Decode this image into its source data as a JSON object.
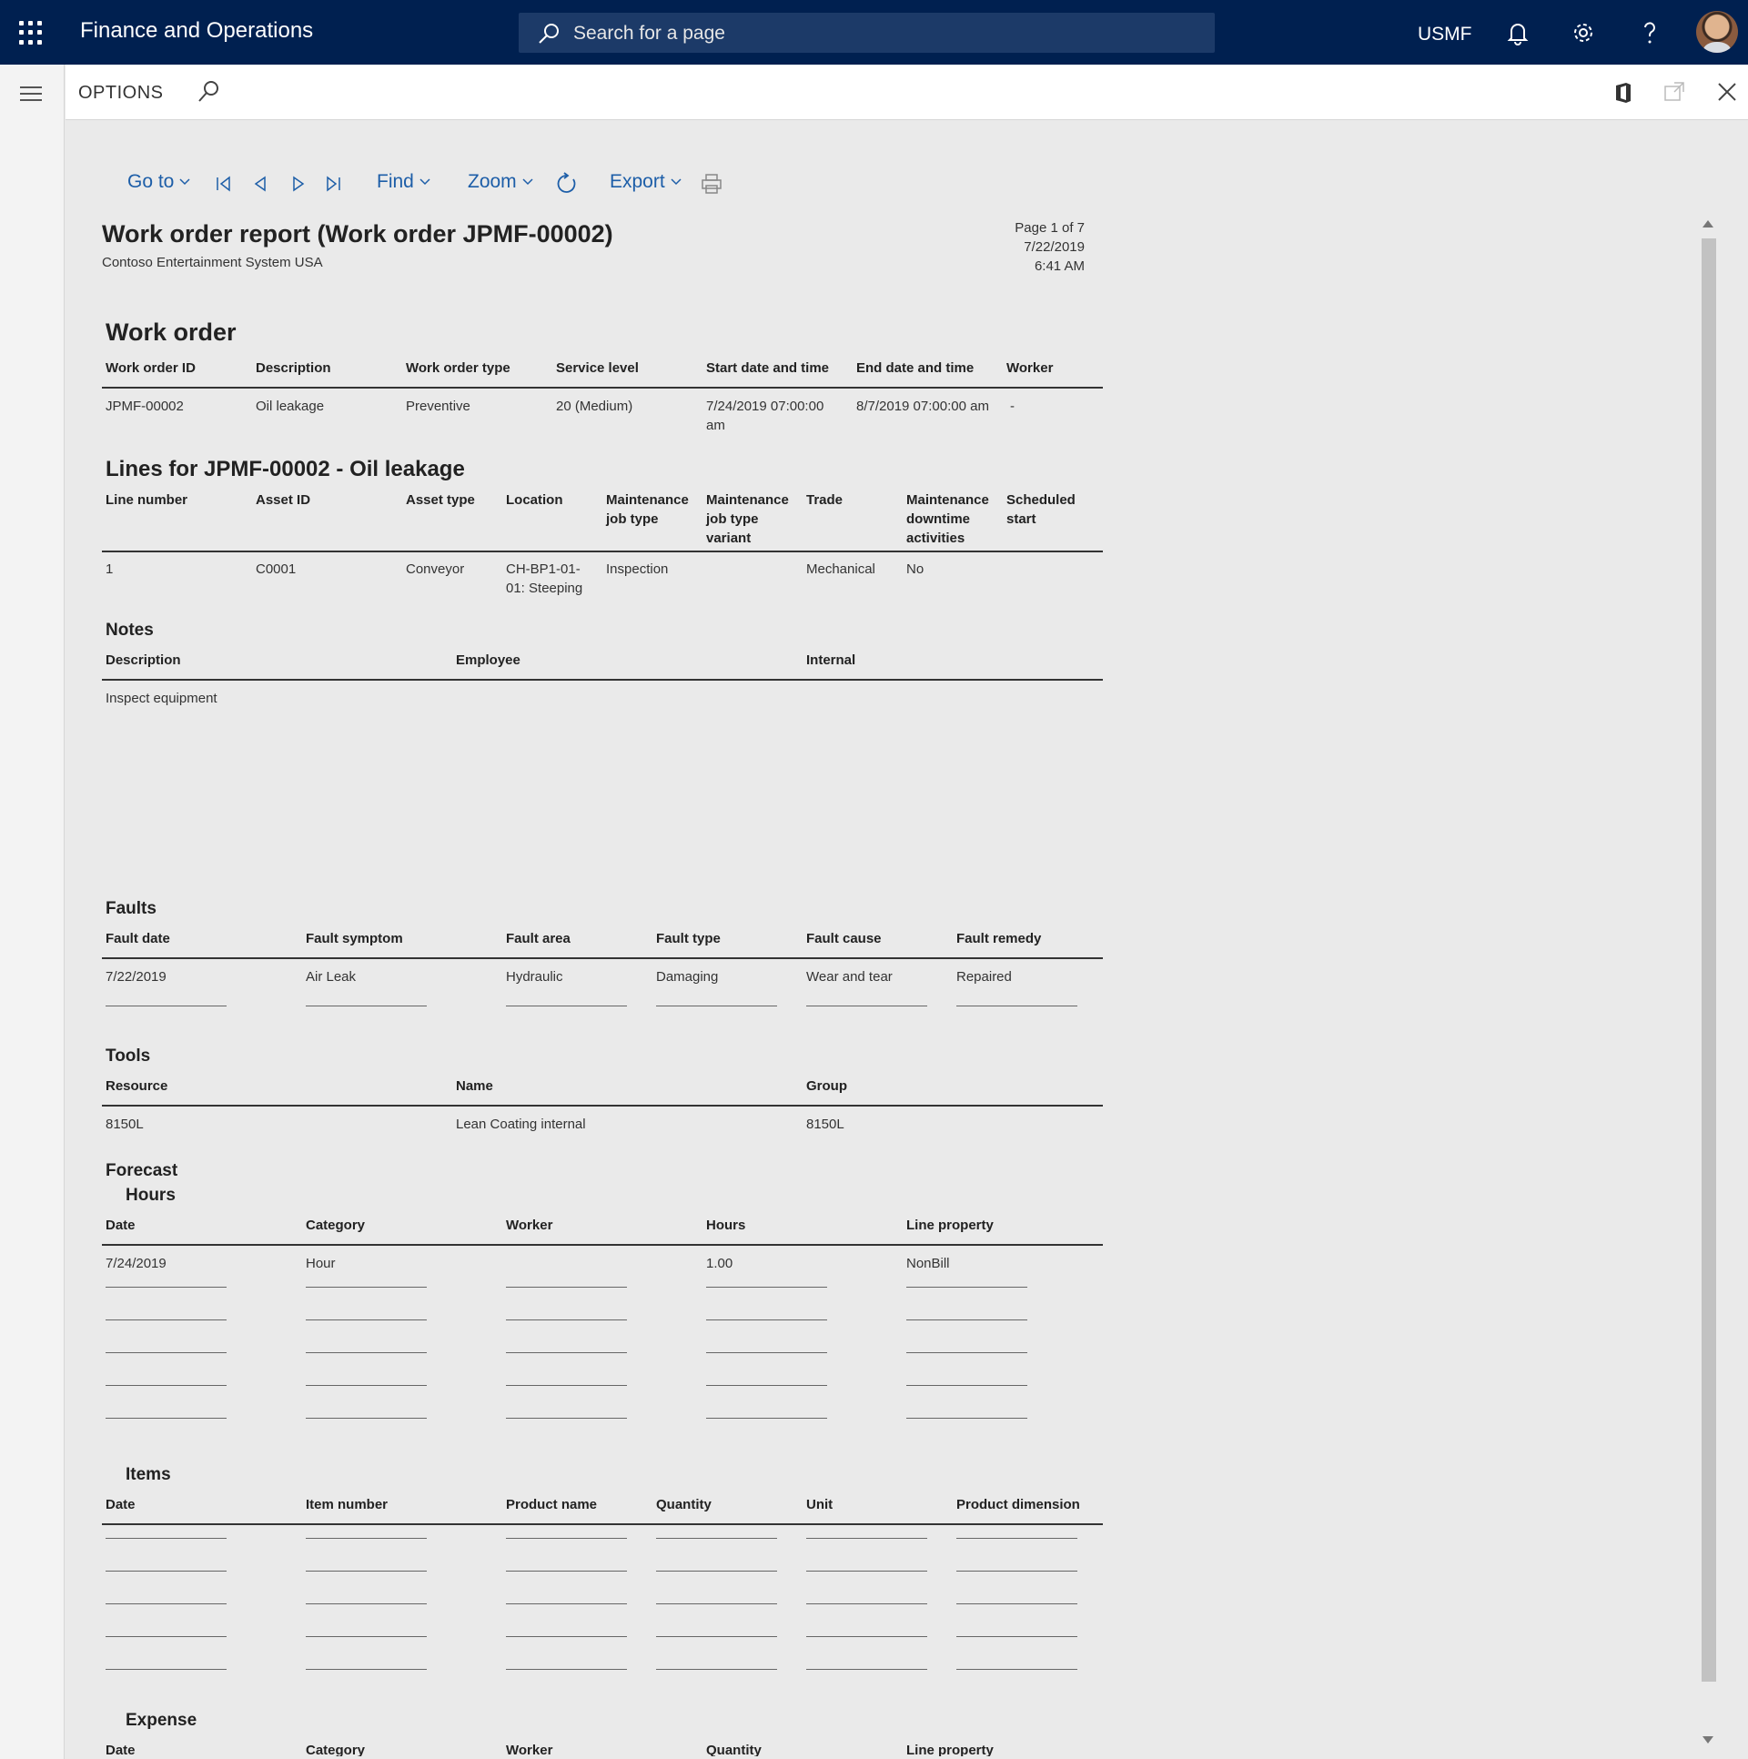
{
  "topbar": {
    "app_title": "Finance and Operations",
    "search_placeholder": "Search for a page",
    "company": "USMF"
  },
  "options": {
    "label": "OPTIONS"
  },
  "toolbar": {
    "goto": "Go to",
    "find": "Find",
    "zoom": "Zoom",
    "export": "Export"
  },
  "report": {
    "title": "Work order report (Work order JPMF-00002)",
    "company": "Contoso Entertainment System USA",
    "page": "Page 1 of 7",
    "date": "7/22/2019",
    "time": "6:41 AM",
    "work_order": {
      "heading": "Work order",
      "headers": [
        "Work order ID",
        "Description",
        "Work order type",
        "Service level",
        "Start date and time",
        "End date and time",
        "Worker"
      ],
      "row": [
        "JPMF-00002",
        "Oil leakage",
        "Preventive",
        "20 (Medium)",
        "7/24/2019 07:00:00 am",
        "8/7/2019 07:00:00 am",
        "-"
      ]
    },
    "lines": {
      "heading": "Lines for JPMF-00002 - Oil leakage",
      "headers": [
        "Line number",
        "Asset ID",
        "Asset type",
        "Location",
        "Maintenance job type",
        "Maintenance job type variant",
        "Trade",
        "Maintenance downtime activities",
        "Scheduled start"
      ],
      "row": [
        "1",
        "C0001",
        "Conveyor",
        "CH-BP1-01-01: Steeping",
        "Inspection",
        "",
        "Mechanical",
        "No",
        ""
      ]
    },
    "notes": {
      "heading": "Notes",
      "headers": [
        "Description",
        "Employee",
        "Internal"
      ],
      "row": [
        "Inspect equipment",
        "",
        ""
      ]
    },
    "faults": {
      "heading": "Faults",
      "headers": [
        "Fault date",
        "Fault symptom",
        "Fault area",
        "Fault type",
        "Fault cause",
        "Fault remedy"
      ],
      "row": [
        "7/22/2019",
        "Air Leak",
        "Hydraulic",
        "Damaging",
        "Wear and tear",
        "Repaired"
      ]
    },
    "tools": {
      "heading": "Tools",
      "headers": [
        "Resource",
        "Name",
        "Group"
      ],
      "row": [
        "8150L",
        "Lean Coating internal",
        "8150L"
      ]
    },
    "forecast": {
      "heading": "Forecast",
      "hours": {
        "heading": "Hours",
        "headers": [
          "Date",
          "Category",
          "Worker",
          "Hours",
          "Line property"
        ],
        "row": [
          "7/24/2019",
          "Hour",
          "",
          "1.00",
          "NonBill"
        ]
      },
      "items": {
        "heading": "Items",
        "headers": [
          "Date",
          "Item number",
          "Product name",
          "Quantity",
          "Unit",
          "Product dimension"
        ]
      },
      "expense": {
        "heading": "Expense",
        "headers": [
          "Date",
          "Category",
          "Worker",
          "Quantity",
          "Line property"
        ]
      }
    }
  }
}
